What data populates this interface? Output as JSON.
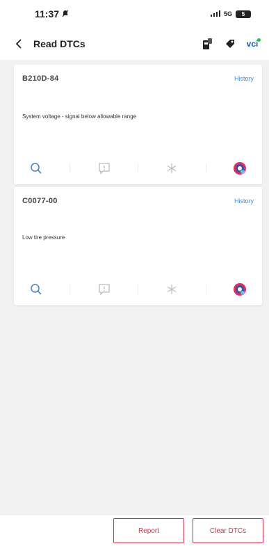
{
  "status_bar": {
    "time": "11:37",
    "network": "5G",
    "battery": "5"
  },
  "header": {
    "title": "Read DTCs",
    "vci_label": "vci"
  },
  "dtcs": [
    {
      "code": "B210D-84",
      "history_label": "History",
      "description": "System voltage - signal below allowable range"
    },
    {
      "code": "C0077-00",
      "history_label": "History",
      "description": "Low tire pressure"
    }
  ],
  "footer": {
    "report_label": "Report",
    "clear_label": "Clear DTCs"
  },
  "colors": {
    "accent": "#c3374a",
    "link": "#4a86c8",
    "icon_blue": "#4a86c8",
    "icon_gray": "#bbbbbb"
  },
  "icons": [
    "back-arrow-icon",
    "device-icon",
    "tag-icon",
    "search-icon",
    "info-icon",
    "freeze-frame-icon",
    "ai-assistant-icon"
  ]
}
